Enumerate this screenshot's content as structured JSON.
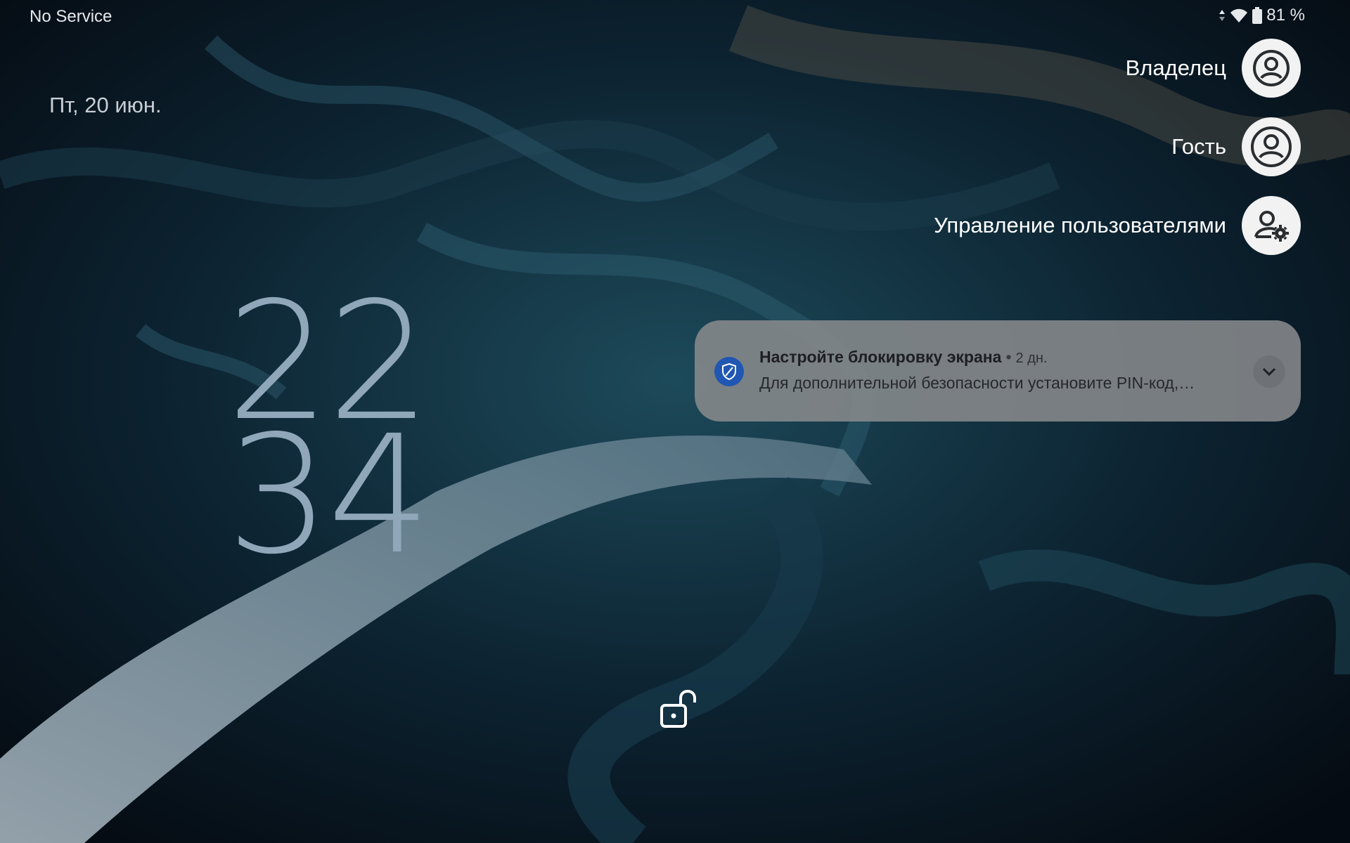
{
  "status_bar": {
    "carrier": "No Service",
    "battery_percent": "81 %",
    "icons": [
      "data-arrows-icon",
      "wifi-icon",
      "battery-icon"
    ]
  },
  "lockscreen": {
    "date": "Пт, 20 июн.",
    "clock": {
      "hours": "22",
      "minutes": "34"
    }
  },
  "users": [
    {
      "label": "Владелец",
      "icon": "owner-avatar-icon"
    },
    {
      "label": "Гость",
      "icon": "guest-avatar-icon"
    },
    {
      "label": "Управление пользователями",
      "icon": "manage-users-icon"
    }
  ],
  "notification": {
    "title": "Настройте блокировку экрана",
    "time": "2 дн.",
    "body": "Для дополнительной безопасности установите PIN-код,…",
    "icon": "shield-icon",
    "expand_icon": "chevron-down-icon"
  },
  "bottom": {
    "icon": "unlock-icon"
  },
  "colors": {
    "background": "#07111b",
    "clock": "#8fa7b8",
    "notification_bg": "#878a8c",
    "notification_icon": "#1f57b3"
  }
}
